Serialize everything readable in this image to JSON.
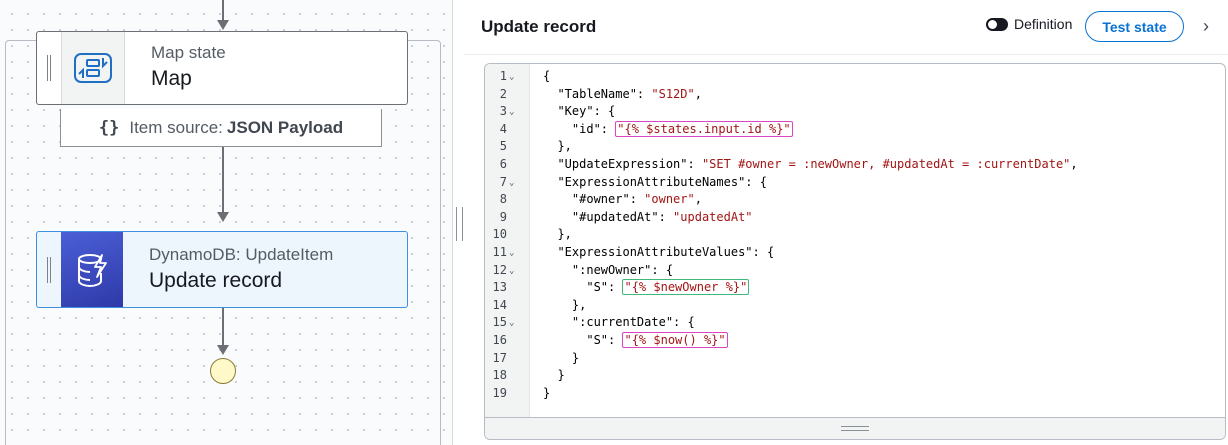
{
  "workflow": {
    "map_state": {
      "type_label": "Map state",
      "name": "Map"
    },
    "item_source": {
      "prefix": "Item source:",
      "value": "JSON Payload"
    },
    "dynamo_state": {
      "type_label": "DynamoDB: UpdateItem",
      "name": "Update record"
    }
  },
  "panel": {
    "title": "Update record",
    "toggle_label": "Definition",
    "toggle_on": false,
    "test_button": "Test state",
    "chevron": "›"
  },
  "editor": {
    "lines": [
      {
        "n": "1",
        "fold": true,
        "code": "{"
      },
      {
        "n": "2",
        "fold": false,
        "code": "  \"TableName\": \"S12D\","
      },
      {
        "n": "3",
        "fold": true,
        "code": "  \"Key\": {"
      },
      {
        "n": "4",
        "fold": false,
        "code": "    \"id\": \"{% $states.input.id %}\""
      },
      {
        "n": "5",
        "fold": false,
        "code": "  },"
      },
      {
        "n": "6",
        "fold": false,
        "code": "  \"UpdateExpression\": \"SET #owner = :newOwner, #updatedAt = :currentDate\","
      },
      {
        "n": "7",
        "fold": true,
        "code": "  \"ExpressionAttributeNames\": {"
      },
      {
        "n": "8",
        "fold": false,
        "code": "    \"#owner\": \"owner\","
      },
      {
        "n": "9",
        "fold": false,
        "code": "    \"#updatedAt\": \"updatedAt\""
      },
      {
        "n": "10",
        "fold": false,
        "code": "  },"
      },
      {
        "n": "11",
        "fold": true,
        "code": "  \"ExpressionAttributeValues\": {"
      },
      {
        "n": "12",
        "fold": true,
        "code": "    \":newOwner\": {"
      },
      {
        "n": "13",
        "fold": false,
        "code": "      \"S\": \"{% $newOwner %}\""
      },
      {
        "n": "14",
        "fold": false,
        "code": "    },"
      },
      {
        "n": "15",
        "fold": true,
        "code": "    \":currentDate\": {"
      },
      {
        "n": "16",
        "fold": false,
        "code": "      \"S\": \"{% $now() %}\""
      },
      {
        "n": "17",
        "fold": false,
        "code": "    }"
      },
      {
        "n": "18",
        "fold": false,
        "code": "  }"
      },
      {
        "n": "19",
        "fold": false,
        "code": "}"
      }
    ]
  },
  "colors": {
    "accent": "#0972d3",
    "selected_border": "#3d8fe0",
    "dynamo_icon": "#3f4fc9",
    "string": "#a31515",
    "jsonata_box_pink": "#d946c4",
    "jsonata_box_green": "#3fb87a",
    "end_node": "#fff8c9"
  },
  "icons": {
    "map_icon": "map-state-icon",
    "dynamo_icon": "dynamodb-icon",
    "braces_icon": "braces-icon",
    "chevron_icon": "chevron-right-icon"
  }
}
